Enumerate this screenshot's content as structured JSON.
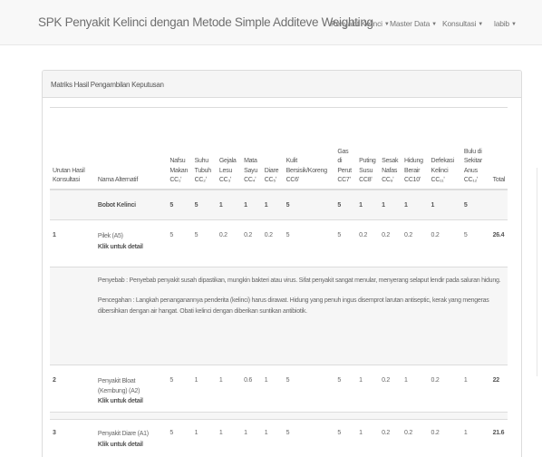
{
  "navbar": {
    "brand": "SPK Penyakit Kelinci dengan Metode Simple Additeve Weighting",
    "menu": [
      {
        "label": "Penyakit Kelinci"
      },
      {
        "label": "Master Data"
      },
      {
        "label": "Konsultasi"
      },
      {
        "label": "labib"
      }
    ]
  },
  "panel": {
    "title": "Matriks Hasil Pengambilan Keputusan"
  },
  "table": {
    "headers": {
      "urutan": "Urutan Hasil Konsultasi",
      "nama": "Nama Alternatif",
      "c1": "Nafsu Makan CC₁ʹ",
      "c2": "Suhu Tubuh CC₂ʹ",
      "c3": "Gejala Lesu CC₃ʹ",
      "c4": "Mata Sayu CC₄ʹ",
      "c5": "Diare CC₅ʹ",
      "c6": "Kulit Bersisik/Koreng CC6ʹ",
      "c7": "Gas di Perut CC7ʹ",
      "c8": "Puting Susu CC8ʹ",
      "c9": "Sesak Nafas CC₉ʹ",
      "c10": "Hidung Berair CC10ʹ",
      "c11": "Defekasi Kelinci CC₁₁ʹ",
      "c12": "Bulu di Sekitar Anus CC₁₂ʹ",
      "total": "Total"
    },
    "bobot": {
      "label": "Bobot Kelinci",
      "values": [
        "5",
        "5",
        "1",
        "1",
        "1",
        "5",
        "5",
        "1",
        "1",
        "1",
        "1",
        "5"
      ]
    },
    "rows": [
      {
        "rank": "1",
        "name": "Pilek (A5)",
        "detail": "Klik untuk detail",
        "values": [
          "5",
          "5",
          "0.2",
          "0.2",
          "0.2",
          "5",
          "5",
          "0.2",
          "0.2",
          "0.2",
          "0.2",
          "5"
        ],
        "total": "26.4"
      },
      {
        "rank": "2",
        "name": "Penyakit Bloat (Kembung) (A2)",
        "detail": "Klik untuk detail",
        "values": [
          "5",
          "1",
          "1",
          "0.6",
          "1",
          "5",
          "5",
          "1",
          "0.2",
          "1",
          "0.2",
          "1"
        ],
        "total": "22"
      },
      {
        "rank": "3",
        "name": "Penyakit Diare (A1)",
        "detail": "Klik untuk detail",
        "values": [
          "5",
          "1",
          "1",
          "1",
          "1",
          "5",
          "5",
          "1",
          "0.2",
          "0.2",
          "0.2",
          "1"
        ],
        "total": "21.6"
      }
    ],
    "detail_expanded": {
      "penyebab": "Penyebab : Penyebab penyakit susah dipastikan, mungkin bakteri atau virus. Sifat penyakit sangat menular, menyerang selaput lendir pada saluran hidung.",
      "pencegahan": "Pencegahan : Langkah penanganannya penderita (kelinci) harus dirawat. Hidung yang penuh ingus disemprot larutan antiseptic, kerak yang mengeras dibersihkan dengan air hangat. Obati kelinci dengan diberikan suntikan antibiotik."
    }
  }
}
